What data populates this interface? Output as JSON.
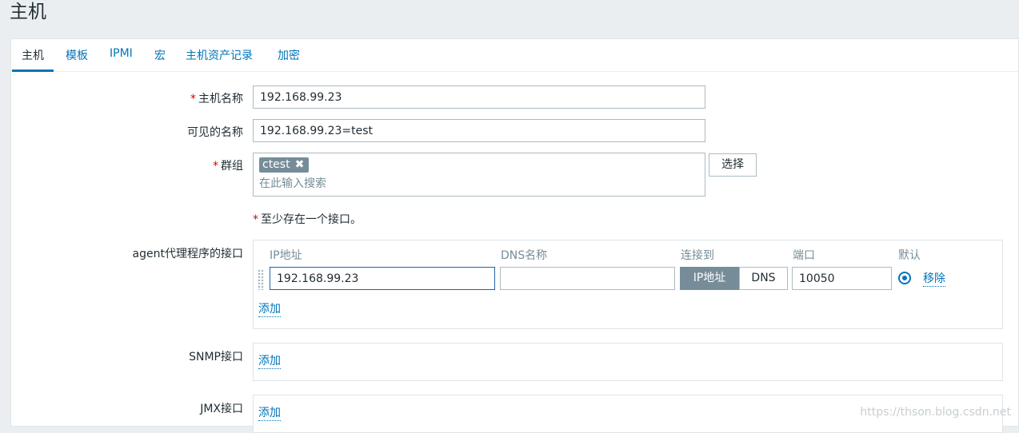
{
  "page": {
    "title": "主机"
  },
  "tabs": [
    {
      "label": "主机"
    },
    {
      "label": "模板"
    },
    {
      "label": "IPMI"
    },
    {
      "label": "宏"
    },
    {
      "label": "主机资产记录"
    },
    {
      "label": "加密"
    }
  ],
  "form": {
    "required_mark": "*",
    "host_name": {
      "label": "主机名称",
      "value": "192.168.99.23"
    },
    "visible_name": {
      "label": "可见的名称",
      "value": "192.168.99.23=test"
    },
    "groups": {
      "label": "群组",
      "chip": "ctest",
      "chip_remove": "✖",
      "placeholder": "在此输入搜索",
      "select_button": "选择"
    },
    "interface_note": "至少存在一个接口。",
    "agent": {
      "label": "agent代理程序的接口",
      "columns": {
        "ip": "IP地址",
        "dns": "DNS名称",
        "connect": "连接到",
        "port": "端口",
        "default": "默认"
      },
      "row": {
        "ip": "192.168.99.23",
        "dns": "",
        "connect_ip": "IP地址",
        "connect_dns": "DNS",
        "port": "10050",
        "remove": "移除"
      },
      "add": "添加"
    },
    "snmp": {
      "label": "SNMP接口",
      "add": "添加"
    },
    "jmx": {
      "label": "JMX接口",
      "add": "添加"
    }
  },
  "watermark": "https://thson.blog.csdn.net",
  "colors": {
    "accent": "#0275b8",
    "required": "#d40000",
    "chip_bg": "#768d99"
  }
}
